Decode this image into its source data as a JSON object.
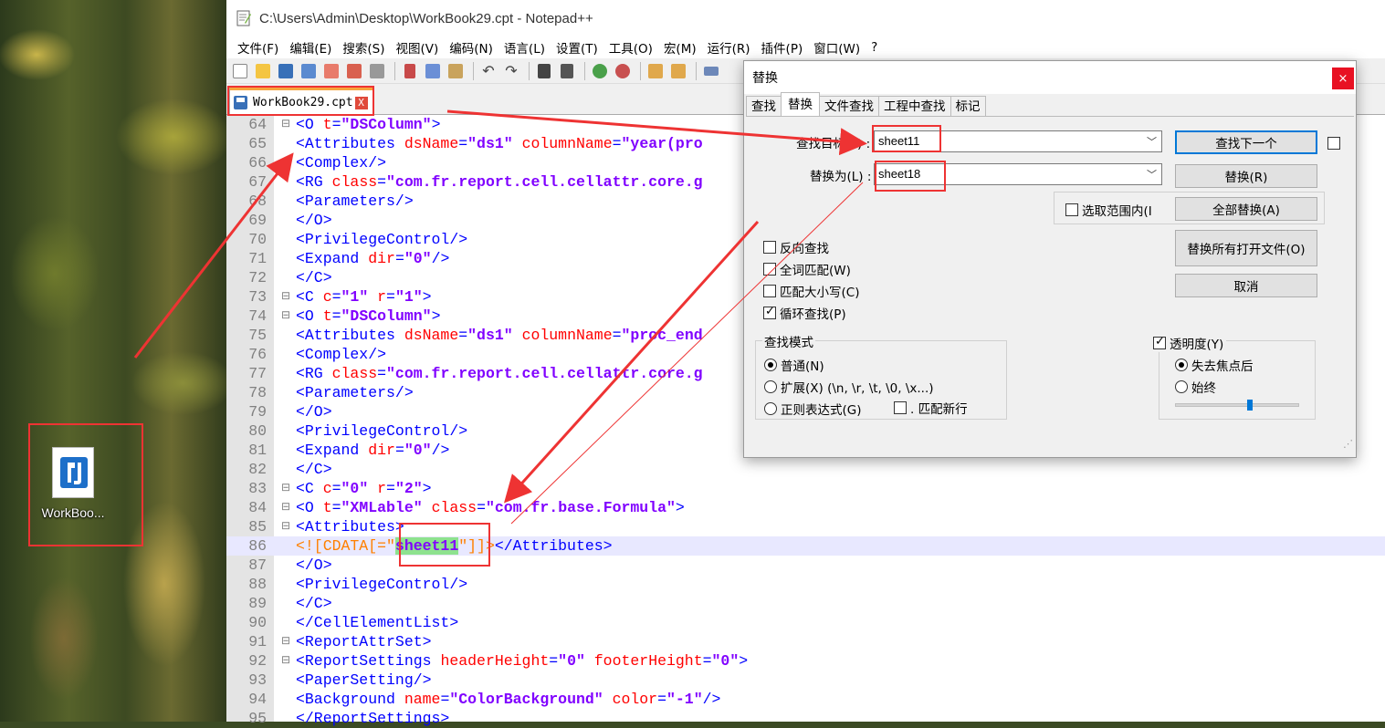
{
  "desktop": {
    "file_icon_label": "WorkBoo..."
  },
  "window": {
    "title": "C:\\Users\\Admin\\Desktop\\WorkBook29.cpt - Notepad++"
  },
  "menu": [
    "文件(F)",
    "编辑(E)",
    "搜索(S)",
    "视图(V)",
    "编码(N)",
    "语言(L)",
    "设置(T)",
    "工具(O)",
    "宏(M)",
    "运行(R)",
    "插件(P)",
    "窗口(W)",
    "?"
  ],
  "tab": {
    "label": "WorkBook29.cpt",
    "close": "X"
  },
  "code_lines": [
    {
      "n": "64",
      "fold": "⊟",
      "parts": [
        [
          "t",
          "<O "
        ],
        [
          "a",
          "t"
        ],
        [
          "p",
          "="
        ],
        [
          "v",
          "\"DSColumn\""
        ],
        [
          "t",
          ">"
        ]
      ]
    },
    {
      "n": "65",
      "fold": "",
      "parts": [
        [
          "t",
          "<Attributes "
        ],
        [
          "a",
          "dsName"
        ],
        [
          "p",
          "="
        ],
        [
          "v",
          "\"ds1\" "
        ],
        [
          "a",
          "columnName"
        ],
        [
          "p",
          "="
        ],
        [
          "v",
          "\"year(pro"
        ]
      ]
    },
    {
      "n": "66",
      "fold": "",
      "parts": [
        [
          "t",
          "<Complex/>"
        ]
      ]
    },
    {
      "n": "67",
      "fold": "",
      "parts": [
        [
          "t",
          "<RG "
        ],
        [
          "a",
          "class"
        ],
        [
          "p",
          "="
        ],
        [
          "v",
          "\"com.fr.report.cell.cellattr.core.g"
        ]
      ]
    },
    {
      "n": "68",
      "fold": "",
      "parts": [
        [
          "t",
          "<Parameters/>"
        ]
      ]
    },
    {
      "n": "69",
      "fold": "",
      "parts": [
        [
          "t",
          "</O>"
        ]
      ]
    },
    {
      "n": "70",
      "fold": "",
      "parts": [
        [
          "t",
          "<PrivilegeControl/>"
        ]
      ]
    },
    {
      "n": "71",
      "fold": "",
      "parts": [
        [
          "t",
          "<Expand "
        ],
        [
          "a",
          "dir"
        ],
        [
          "p",
          "="
        ],
        [
          "v",
          "\"0\""
        ],
        [
          "t",
          "/>"
        ]
      ]
    },
    {
      "n": "72",
      "fold": "",
      "parts": [
        [
          "t",
          "</C>"
        ]
      ]
    },
    {
      "n": "73",
      "fold": "⊟",
      "parts": [
        [
          "t",
          "<C "
        ],
        [
          "a",
          "c"
        ],
        [
          "p",
          "="
        ],
        [
          "v",
          "\"1\" "
        ],
        [
          "a",
          "r"
        ],
        [
          "p",
          "="
        ],
        [
          "v",
          "\"1\""
        ],
        [
          "t",
          ">"
        ]
      ]
    },
    {
      "n": "74",
      "fold": "⊟",
      "parts": [
        [
          "t",
          "<O "
        ],
        [
          "a",
          "t"
        ],
        [
          "p",
          "="
        ],
        [
          "v",
          "\"DSColumn\""
        ],
        [
          "t",
          ">"
        ]
      ]
    },
    {
      "n": "75",
      "fold": "",
      "parts": [
        [
          "t",
          "<Attributes "
        ],
        [
          "a",
          "dsName"
        ],
        [
          "p",
          "="
        ],
        [
          "v",
          "\"ds1\" "
        ],
        [
          "a",
          "columnName"
        ],
        [
          "p",
          "="
        ],
        [
          "v",
          "\"proc_end"
        ]
      ]
    },
    {
      "n": "76",
      "fold": "",
      "parts": [
        [
          "t",
          "<Complex/>"
        ]
      ]
    },
    {
      "n": "77",
      "fold": "",
      "parts": [
        [
          "t",
          "<RG "
        ],
        [
          "a",
          "class"
        ],
        [
          "p",
          "="
        ],
        [
          "v",
          "\"com.fr.report.cell.cellattr.core.g"
        ]
      ]
    },
    {
      "n": "78",
      "fold": "",
      "parts": [
        [
          "t",
          "<Parameters/>"
        ]
      ]
    },
    {
      "n": "79",
      "fold": "",
      "parts": [
        [
          "t",
          "</O>"
        ]
      ]
    },
    {
      "n": "80",
      "fold": "",
      "parts": [
        [
          "t",
          "<PrivilegeControl/>"
        ]
      ]
    },
    {
      "n": "81",
      "fold": "",
      "parts": [
        [
          "t",
          "<Expand "
        ],
        [
          "a",
          "dir"
        ],
        [
          "p",
          "="
        ],
        [
          "v",
          "\"0\""
        ],
        [
          "t",
          "/>"
        ]
      ]
    },
    {
      "n": "82",
      "fold": "",
      "parts": [
        [
          "t",
          "</C>"
        ]
      ]
    },
    {
      "n": "83",
      "fold": "⊟",
      "parts": [
        [
          "t",
          "<C "
        ],
        [
          "a",
          "c"
        ],
        [
          "p",
          "="
        ],
        [
          "v",
          "\"0\" "
        ],
        [
          "a",
          "r"
        ],
        [
          "p",
          "="
        ],
        [
          "v",
          "\"2\""
        ],
        [
          "t",
          ">"
        ]
      ]
    },
    {
      "n": "84",
      "fold": "⊟",
      "parts": [
        [
          "t",
          "<O "
        ],
        [
          "a",
          "t"
        ],
        [
          "p",
          "="
        ],
        [
          "v",
          "\"XMLable\" "
        ],
        [
          "a",
          "class"
        ],
        [
          "p",
          "="
        ],
        [
          "v",
          "\"com.fr.base.Formula\""
        ],
        [
          "t",
          ">"
        ]
      ]
    },
    {
      "n": "85",
      "fold": "⊟",
      "parts": [
        [
          "t",
          "<Attributes>"
        ]
      ]
    },
    {
      "n": "86",
      "fold": "",
      "current": true,
      "parts": [
        [
          "c",
          "<![CDATA[=\""
        ],
        [
          "h",
          "sheet11"
        ],
        [
          "c",
          "\"]]>"
        ],
        [
          "t",
          "</Attributes>"
        ]
      ]
    },
    {
      "n": "87",
      "fold": "",
      "parts": [
        [
          "t",
          "</O>"
        ]
      ]
    },
    {
      "n": "88",
      "fold": "",
      "parts": [
        [
          "t",
          "<PrivilegeControl/>"
        ]
      ]
    },
    {
      "n": "89",
      "fold": "",
      "parts": [
        [
          "t",
          "</C>"
        ]
      ]
    },
    {
      "n": "90",
      "fold": "",
      "parts": [
        [
          "t",
          "</CellElementList>"
        ]
      ]
    },
    {
      "n": "91",
      "fold": "⊟",
      "parts": [
        [
          "t",
          "<ReportAttrSet>"
        ]
      ]
    },
    {
      "n": "92",
      "fold": "⊟",
      "parts": [
        [
          "t",
          "<ReportSettings "
        ],
        [
          "a",
          "headerHeight"
        ],
        [
          "p",
          "="
        ],
        [
          "v",
          "\"0\" "
        ],
        [
          "a",
          "footerHeight"
        ],
        [
          "p",
          "="
        ],
        [
          "v",
          "\"0\""
        ],
        [
          "t",
          ">"
        ]
      ]
    },
    {
      "n": "93",
      "fold": "",
      "parts": [
        [
          "t",
          "<PaperSetting/>"
        ]
      ]
    },
    {
      "n": "94",
      "fold": "",
      "parts": [
        [
          "t",
          "<Background "
        ],
        [
          "a",
          "name"
        ],
        [
          "p",
          "="
        ],
        [
          "v",
          "\"ColorBackground\" "
        ],
        [
          "a",
          "color"
        ],
        [
          "p",
          "="
        ],
        [
          "v",
          "\"-1\""
        ],
        [
          "t",
          "/>"
        ]
      ]
    },
    {
      "n": "95",
      "fold": "",
      "parts": [
        [
          "t",
          "</ReportSettings>"
        ]
      ]
    }
  ],
  "dialog": {
    "title": "替换",
    "close": "×",
    "tabs": [
      "查找",
      "替换",
      "文件查找",
      "工程中查找",
      "标记"
    ],
    "find_label": "查找目标(F) :",
    "find_value": "sheet11",
    "replace_label": "替换为(L) :",
    "replace_value": "sheet18",
    "in_selection": "选取范围内(I",
    "buttons": {
      "find_next": "查找下一个",
      "replace": "替换(R)",
      "replace_all": "全部替换(A)",
      "replace_all_open": "替换所有打开文件(O)",
      "cancel": "取消"
    },
    "options": [
      {
        "label": "反向查找",
        "checked": false
      },
      {
        "label": "全词匹配(W)",
        "checked": false
      },
      {
        "label": "匹配大小写(C)",
        "checked": false
      },
      {
        "label": "循环查找(P)",
        "checked": true
      }
    ],
    "search_mode": {
      "title": "查找模式",
      "normal": "普通(N)",
      "extended": "扩展(X) (\\n, \\r, \\t, \\0, \\x...)",
      "regex": "正则表达式(G)",
      "dot_newline": ". 匹配新行",
      "selected": "normal"
    },
    "transparency": {
      "title": "透明度(Y)",
      "checked": true,
      "on_lose_focus": "失去焦点后",
      "always": "始终",
      "selected": "on_lose_focus",
      "level": 0.6
    }
  },
  "colors": {
    "annotation": "#ee3333",
    "highlight": "#8ee28e",
    "tag": "#0000ff",
    "attr": "#ff0000",
    "value": "#8000ff"
  }
}
